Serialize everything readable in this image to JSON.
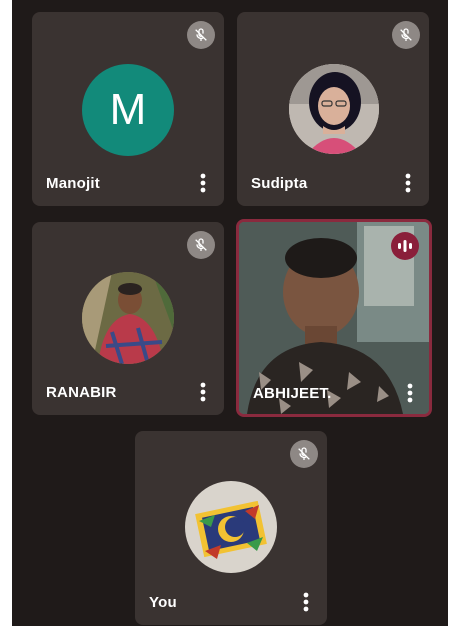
{
  "participants": [
    {
      "name": "Manojit",
      "avatar_letter": "M",
      "avatar_color": "#128a7a",
      "muted": true
    },
    {
      "name": "Sudipta",
      "muted": true
    },
    {
      "name": "RANABIR",
      "muted": true
    },
    {
      "name": "ABHIJEET.",
      "speaking": true
    },
    {
      "name": "You",
      "muted": true
    }
  ],
  "icons": {
    "mute": "mic-off-icon",
    "speaking": "audio-level-icon",
    "more": "more-vertical-icon"
  },
  "colors": {
    "background": "#1f1a19",
    "tile": "#3a3331",
    "active_border": "#8a2a3e",
    "mute_badge": "#8e8885",
    "speaking_badge": "#8a1f3a"
  }
}
